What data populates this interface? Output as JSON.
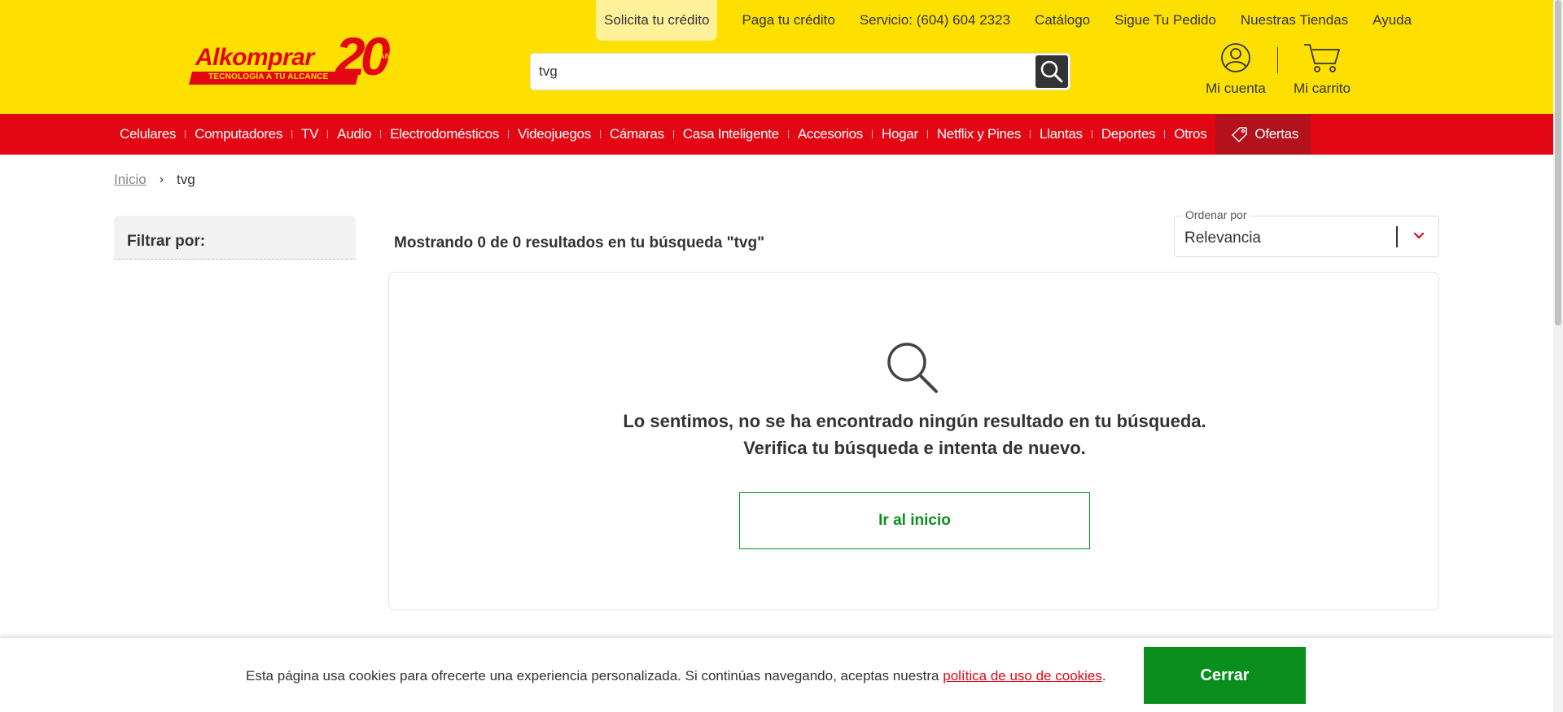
{
  "header": {
    "logo": {
      "brand": "Alkomprar",
      "tagline": "TECNOLOGÍA A TU ALCANCE",
      "anniversary": "20",
      "anniversary_label": "Años"
    },
    "top_links": [
      {
        "label": "Solicita tu crédito"
      },
      {
        "label": "Paga tu crédito"
      },
      {
        "label": "Servicio: (604) 604 2323"
      },
      {
        "label": "Catálogo"
      },
      {
        "label": "Sigue Tu Pedido"
      },
      {
        "label": "Nuestras Tiendas"
      },
      {
        "label": "Ayuda"
      }
    ],
    "search": {
      "value": "tvg",
      "icon": "search-icon"
    },
    "account_label": "Mi cuenta",
    "cart_label": "Mi carrito"
  },
  "categories": [
    {
      "label": "Celulares"
    },
    {
      "label": "Computadores"
    },
    {
      "label": "TV"
    },
    {
      "label": "Audio"
    },
    {
      "label": "Electrodomésticos"
    },
    {
      "label": "Videojuegos"
    },
    {
      "label": "Cámaras"
    },
    {
      "label": "Casa Inteligente"
    },
    {
      "label": "Accesorios"
    },
    {
      "label": "Hogar"
    },
    {
      "label": "Netflix y Pines"
    },
    {
      "label": "Llantas"
    },
    {
      "label": "Deportes"
    },
    {
      "label": "Otros"
    }
  ],
  "offers_label": "Ofertas",
  "breadcrumb": {
    "home": "Inicio",
    "current": "tvg"
  },
  "filter": {
    "title": "Filtrar por:"
  },
  "results": {
    "count_text": "Mostrando 0 de 0 resultados en tu búsqueda \"tvg\""
  },
  "sort": {
    "label": "Ordenar por",
    "value": "Relevancia"
  },
  "empty_state": {
    "line1": "Lo sentimos, no se ha encontrado ningún resultado en tu búsqueda.",
    "line2": "Verifica tu búsqueda e intenta de nuevo.",
    "button": "Ir al inicio"
  },
  "cookie": {
    "text": "Esta página usa cookies para ofrecerte una experiencia personalizada. Si continúas navegando, aceptas nuestra",
    "link": "política de uso de cookies",
    "suffix": ".",
    "button": "Cerrar"
  },
  "colors": {
    "header_bg": "#fee000",
    "nav_bg": "#e30613",
    "offers_bg": "#b3121c",
    "accent_green": "#0a8f1f"
  }
}
